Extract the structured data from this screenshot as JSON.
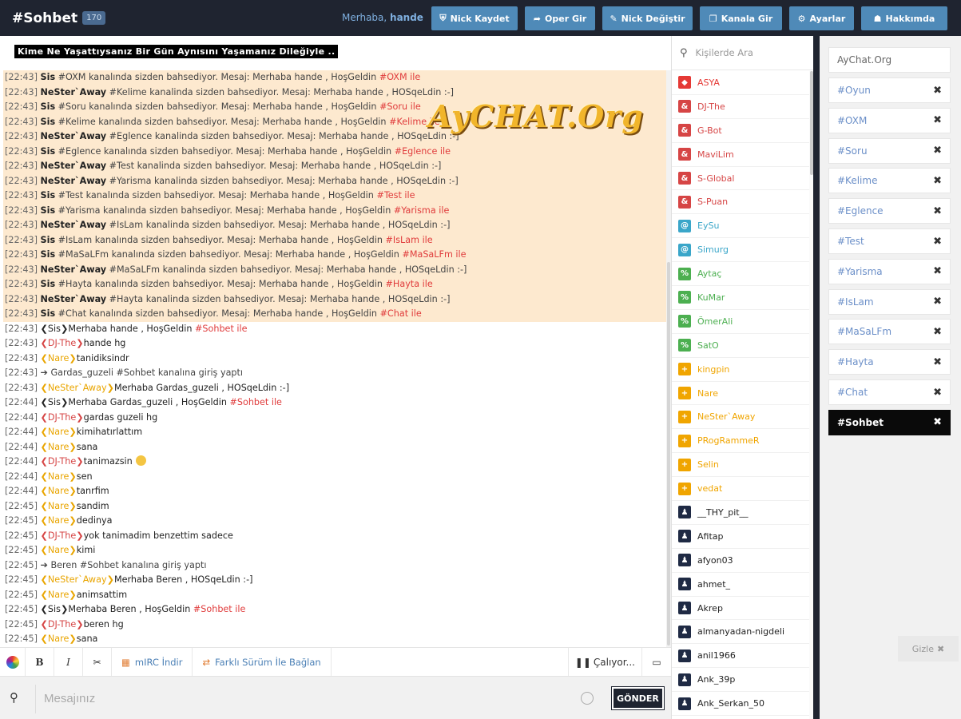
{
  "header": {
    "channel": "#Sohbet",
    "count": "170",
    "greeting_prefix": "Merhaba,",
    "greeting_nick": "hande",
    "buttons": [
      {
        "label": "Nick Kaydet",
        "icon": "shield-icon"
      },
      {
        "label": "Oper Gir",
        "icon": "share-icon"
      },
      {
        "label": "Nick Değiştir",
        "icon": "user-edit-icon"
      },
      {
        "label": "Kanala Gir",
        "icon": "window-icon"
      },
      {
        "label": "Ayarlar",
        "icon": "gear-icon"
      },
      {
        "label": "Hakkımda",
        "icon": "info-icon"
      }
    ]
  },
  "topic": "Kime Ne Yaşattıysanız Bir Gün Aynısını Yaşamanız Dileğiyle ..",
  "watermark": "AyCHAT.Org",
  "messages": [
    {
      "ts": "[22:43]",
      "nick": "Sis",
      "text": "#OXM kanalında sizden bahsediyor. Mesaj: Merhaba hande , HoşGeldin",
      "chan": "#OXM ile",
      "hl": true
    },
    {
      "ts": "[22:43]",
      "nick": "NeSter`Away",
      "text": "#Kelime kanalinda sizden bahsediyor. Mesaj: Merhaba hande , HOSqeLdin :-]",
      "chan": "",
      "hl": true
    },
    {
      "ts": "[22:43]",
      "nick": "Sis",
      "text": "#Soru kanalında sizden bahsediyor. Mesaj: Merhaba hande , HoşGeldin",
      "chan": "#Soru ile",
      "hl": true
    },
    {
      "ts": "[22:43]",
      "nick": "Sis",
      "text": "#Kelime kanalında sizden bahsediyor. Mesaj: Merhaba hande , HoşGeldin",
      "chan": "#Kelime ile",
      "hl": true
    },
    {
      "ts": "[22:43]",
      "nick": "NeSter`Away",
      "text": "#Eglence kanalinda sizden bahsediyor. Mesaj: Merhaba hande , HOSqeLdin :-]",
      "chan": "",
      "hl": true
    },
    {
      "ts": "[22:43]",
      "nick": "Sis",
      "text": "#Eglence kanalında sizden bahsediyor. Mesaj: Merhaba hande , HoşGeldin",
      "chan": "#Eglence ile",
      "hl": true
    },
    {
      "ts": "[22:43]",
      "nick": "NeSter`Away",
      "text": "#Test kanalinda sizden bahsediyor. Mesaj: Merhaba hande , HOSqeLdin :-]",
      "chan": "",
      "hl": true
    },
    {
      "ts": "[22:43]",
      "nick": "NeSter`Away",
      "text": "#Yarisma kanalinda sizden bahsediyor. Mesaj: Merhaba hande , HOSqeLdin :-]",
      "chan": "",
      "hl": true
    },
    {
      "ts": "[22:43]",
      "nick": "Sis",
      "text": "#Test kanalında sizden bahsediyor. Mesaj: Merhaba hande , HoşGeldin",
      "chan": "#Test ile",
      "hl": true
    },
    {
      "ts": "[22:43]",
      "nick": "Sis",
      "text": "#Yarisma kanalında sizden bahsediyor. Mesaj: Merhaba hande , HoşGeldin",
      "chan": "#Yarisma ile",
      "hl": true
    },
    {
      "ts": "[22:43]",
      "nick": "NeSter`Away",
      "text": "#IsLam kanalinda sizden bahsediyor. Mesaj: Merhaba hande , HOSqeLdin :-]",
      "chan": "",
      "hl": true
    },
    {
      "ts": "[22:43]",
      "nick": "Sis",
      "text": "#IsLam kanalında sizden bahsediyor. Mesaj: Merhaba hande , HoşGeldin",
      "chan": "#IsLam ile",
      "hl": true
    },
    {
      "ts": "[22:43]",
      "nick": "Sis",
      "text": "#MaSaLFm kanalında sizden bahsediyor. Mesaj: Merhaba hande , HoşGeldin",
      "chan": "#MaSaLFm ile",
      "hl": true
    },
    {
      "ts": "[22:43]",
      "nick": "NeSter`Away",
      "text": "#MaSaLFm kanalinda sizden bahsediyor. Mesaj: Merhaba hande , HOSqeLdin :-]",
      "chan": "",
      "hl": true
    },
    {
      "ts": "[22:43]",
      "nick": "Sis",
      "text": "#Hayta kanalında sizden bahsediyor. Mesaj: Merhaba hande , HoşGeldin",
      "chan": "#Hayta ile",
      "hl": true
    },
    {
      "ts": "[22:43]",
      "nick": "NeSter`Away",
      "text": "#Hayta kanalinda sizden bahsediyor. Mesaj: Merhaba hande , HOSqeLdin :-]",
      "chan": "",
      "hl": true
    },
    {
      "ts": "[22:43]",
      "nick": "Sis",
      "text": "#Chat kanalında sizden bahsediyor. Mesaj: Merhaba hande , HoşGeldin",
      "chan": "#Chat ile",
      "hl": true
    },
    {
      "ts": "[22:43]",
      "speaker": "Sis",
      "sc": "sis",
      "text": "Merhaba hande , HoşGeldin",
      "chan": "#Sohbet ile"
    },
    {
      "ts": "[22:43]",
      "speaker": "DJ-The",
      "sc": "dj",
      "text": "hande hg",
      "chan": ""
    },
    {
      "ts": "[22:43]",
      "speaker": "Nare",
      "sc": "nare",
      "text": "tanidiksindr",
      "chan": ""
    },
    {
      "ts": "[22:43]",
      "join": "➔ Gardas_guzeli #Sohbet kanalına giriş yaptı"
    },
    {
      "ts": "[22:43]",
      "speaker": "NeSter`Away",
      "sc": "nes",
      "text": "Merhaba Gardas_guzeli , HOSqeLdin :-]",
      "chan": ""
    },
    {
      "ts": "[22:44]",
      "speaker": "Sis",
      "sc": "sis",
      "text": "Merhaba Gardas_guzeli , HoşGeldin",
      "chan": "#Sohbet ile"
    },
    {
      "ts": "[22:44]",
      "speaker": "DJ-The",
      "sc": "dj",
      "text": "gardas guzeli hg",
      "chan": ""
    },
    {
      "ts": "[22:44]",
      "speaker": "Nare",
      "sc": "nare",
      "text": "kimihatırlattım",
      "chan": ""
    },
    {
      "ts": "[22:44]",
      "speaker": "Nare",
      "sc": "nare",
      "text": "sana",
      "chan": ""
    },
    {
      "ts": "[22:44]",
      "speaker": "DJ-The",
      "sc": "dj",
      "text": "tanimazsin",
      "chan": "",
      "emoji": true
    },
    {
      "ts": "[22:44]",
      "speaker": "Nare",
      "sc": "nare",
      "text": "sen",
      "chan": ""
    },
    {
      "ts": "[22:44]",
      "speaker": "Nare",
      "sc": "nare",
      "text": "tanrfim",
      "chan": ""
    },
    {
      "ts": "[22:45]",
      "speaker": "Nare",
      "sc": "nare",
      "text": "sandim",
      "chan": ""
    },
    {
      "ts": "[22:45]",
      "speaker": "Nare",
      "sc": "nare",
      "text": "dedinya",
      "chan": ""
    },
    {
      "ts": "[22:45]",
      "speaker": "DJ-The",
      "sc": "dj",
      "text": "yok tanimadim benzettim sadece",
      "chan": ""
    },
    {
      "ts": "[22:45]",
      "speaker": "Nare",
      "sc": "nare",
      "text": "kimi",
      "chan": ""
    },
    {
      "ts": "[22:45]",
      "join": "➔ Beren #Sohbet kanalına giriş yaptı"
    },
    {
      "ts": "[22:45]",
      "speaker": "NeSter`Away",
      "sc": "nes",
      "text": "Merhaba Beren , HOSqeLdin :-]",
      "chan": ""
    },
    {
      "ts": "[22:45]",
      "speaker": "Nare",
      "sc": "nare",
      "text": "animsattim",
      "chan": ""
    },
    {
      "ts": "[22:45]",
      "speaker": "Sis",
      "sc": "sis",
      "text": "Merhaba Beren , HoşGeldin",
      "chan": "#Sohbet ile"
    },
    {
      "ts": "[22:45]",
      "speaker": "DJ-The",
      "sc": "dj",
      "text": "beren hg",
      "chan": ""
    },
    {
      "ts": "[22:45]",
      "speaker": "Nare",
      "sc": "nare",
      "text": "sana",
      "chan": ""
    }
  ],
  "toolbar": {
    "bold": "B",
    "italic": "I",
    "mirc_label": "mIRC İndir",
    "alt_label": "Farklı Sürüm İle Bağlan",
    "player_label": "Çalıyor..."
  },
  "input": {
    "placeholder": "Mesajınız",
    "send_label": "GÖNDER"
  },
  "users": {
    "search_placeholder": "Kişilerde Ara",
    "list": [
      {
        "name": "ASYA",
        "mode": "~",
        "color": "#e53935"
      },
      {
        "name": "DJ-The",
        "mode": "&",
        "color": "#d64545"
      },
      {
        "name": "G-Bot",
        "mode": "&",
        "color": "#d64545"
      },
      {
        "name": "MaviLim",
        "mode": "&",
        "color": "#d64545"
      },
      {
        "name": "S-Global",
        "mode": "&",
        "color": "#d64545"
      },
      {
        "name": "S-Puan",
        "mode": "&",
        "color": "#d64545"
      },
      {
        "name": "EySu",
        "mode": "@",
        "color": "#3aa6c9"
      },
      {
        "name": "Simurg",
        "mode": "@",
        "color": "#3aa6c9"
      },
      {
        "name": "Aytaç",
        "mode": "%",
        "color": "#4caf50"
      },
      {
        "name": "KuMar",
        "mode": "%",
        "color": "#4caf50"
      },
      {
        "name": "ÖmerAli",
        "mode": "%",
        "color": "#4caf50"
      },
      {
        "name": "SatO",
        "mode": "%",
        "color": "#4caf50"
      },
      {
        "name": "kingpin",
        "mode": "+",
        "color": "#f0a500"
      },
      {
        "name": "Nare",
        "mode": "+",
        "color": "#f0a500"
      },
      {
        "name": "NeSter`Away",
        "mode": "+",
        "color": "#f0a500"
      },
      {
        "name": "PRogRammeR",
        "mode": "+",
        "color": "#f0a500"
      },
      {
        "name": "Selin",
        "mode": "+",
        "color": "#f0a500"
      },
      {
        "name": "vedat",
        "mode": "+",
        "color": "#f0a500"
      },
      {
        "name": "__THY_pit__",
        "mode": "user",
        "color": "#1f2a44"
      },
      {
        "name": "Afitap",
        "mode": "user",
        "color": "#1f2a44"
      },
      {
        "name": "afyon03",
        "mode": "user",
        "color": "#1f2a44"
      },
      {
        "name": "ahmet_",
        "mode": "user",
        "color": "#1f2a44"
      },
      {
        "name": "Akrep",
        "mode": "user",
        "color": "#1f2a44"
      },
      {
        "name": "almanyadan-nigdeli",
        "mode": "user",
        "color": "#1f2a44"
      },
      {
        "name": "anil1966",
        "mode": "user",
        "color": "#1f2a44"
      },
      {
        "name": "Ank_39p",
        "mode": "user",
        "color": "#1f2a44"
      },
      {
        "name": "Ank_Serkan_50",
        "mode": "user",
        "color": "#1f2a44"
      }
    ]
  },
  "channels": {
    "server": "AyChat.Org",
    "list": [
      "#Oyun",
      "#OXM",
      "#Soru",
      "#Kelime",
      "#Eglence",
      "#Test",
      "#Yarisma",
      "#IsLam",
      "#MaSaLFm",
      "#Hayta",
      "#Chat",
      "#Sohbet"
    ],
    "active": "#Sohbet",
    "hide_label": "Gizle"
  }
}
